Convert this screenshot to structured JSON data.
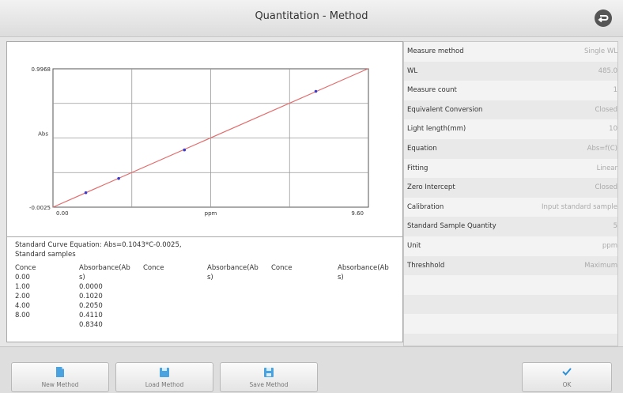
{
  "window": {
    "title": "Quantitation - Method"
  },
  "chart_data": {
    "type": "line",
    "title": "",
    "xlabel": "ppm",
    "ylabel": "Abs",
    "xlim": [
      0,
      9.6
    ],
    "ylim": [
      -0.0025,
      0.9968
    ],
    "x_tick_labels": [
      "0.00",
      "9.60"
    ],
    "y_tick_labels": [
      "0.9968",
      "-0.0025"
    ],
    "grid": true,
    "series": [
      {
        "points": [
          [
            1.0,
            0.102
          ],
          [
            2.0,
            0.205
          ],
          [
            4.0,
            0.411
          ],
          [
            8.0,
            0.834
          ]
        ]
      }
    ],
    "fit_line": {
      "slope": 0.1043,
      "intercept": -0.0025
    },
    "colors": {
      "line": "#e36d6d",
      "points": "#3a3acb"
    }
  },
  "results": {
    "equation": "Standard Curve Equation: Abs=0.1043*C-0.0025,",
    "standard_title": "Standard samples",
    "columns": [
      {
        "cells": [
          "Conce",
          "0.00",
          "1.00",
          "2.00",
          "4.00",
          "8.00"
        ]
      },
      {
        "cells": [
          "Absorbance(Ab",
          "s)",
          "0.0000",
          "0.1020",
          "0.2050",
          "0.4110",
          "0.8340"
        ]
      },
      {
        "cells": [
          "Conce"
        ]
      },
      {
        "cells": [
          "Absorbance(Ab",
          "s)"
        ]
      },
      {
        "cells": [
          "Conce"
        ]
      },
      {
        "cells": [
          "Absorbance(Ab",
          "s)"
        ]
      }
    ]
  },
  "properties": [
    {
      "label": "Measure method",
      "value": "Single WL"
    },
    {
      "label": "WL",
      "value": "485.0"
    },
    {
      "label": "Measure count",
      "value": "1"
    },
    {
      "label": "Equivalent Conversion",
      "value": "Closed"
    },
    {
      "label": "Light length(mm)",
      "value": "10"
    },
    {
      "label": "Equation",
      "value": "Abs=f(C)"
    },
    {
      "label": "Fitting",
      "value": "Linear"
    },
    {
      "label": "Zero Intercept",
      "value": "Closed"
    },
    {
      "label": "Calibration",
      "value": "Input standard sample"
    },
    {
      "label": "Standard Sample Quantity",
      "value": "5"
    },
    {
      "label": "Unit",
      "value": "ppm"
    },
    {
      "label": "Threshhold",
      "value": "Maximum"
    },
    {
      "label": "",
      "value": ""
    },
    {
      "label": "",
      "value": ""
    },
    {
      "label": "",
      "value": ""
    },
    {
      "label": "",
      "value": ""
    }
  ],
  "toolbar": {
    "new_method": "New Method",
    "load_method": "Load Method",
    "save_method": "Save Method",
    "ok": "OK"
  },
  "icons": {
    "back": "return-icon",
    "new": "new-file-icon",
    "load": "folder-icon",
    "save": "save-icon",
    "ok": "check-icon"
  }
}
